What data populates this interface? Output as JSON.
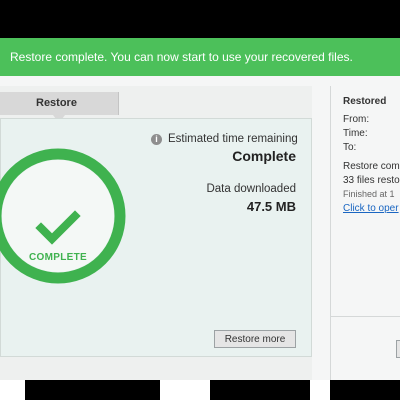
{
  "banner": {
    "message": "Restore complete. You can now start to use your recovered files."
  },
  "restore_tab": {
    "label": "Restore"
  },
  "progress": {
    "eta_label": "Estimated time remaining",
    "eta_value": "Complete",
    "data_label": "Data downloaded",
    "data_value": "47.5 MB",
    "status_text": "COMPLETE",
    "percent": 100
  },
  "actions": {
    "restore_more_label": "Restore more"
  },
  "details": {
    "title": "Restored",
    "from_label": "From:",
    "time_label": "Time:",
    "to_label": "To:",
    "status_line1": "Restore com",
    "status_line2": "33 files resto",
    "finished_text": "Finished at 1",
    "open_link": "Click to oper"
  },
  "colors": {
    "accent": "#4cc05a",
    "ring": "#3fb24f",
    "link": "#1a66c2"
  },
  "icons": {
    "banner": "check-icon",
    "info": "info-icon",
    "status": "checkmark-icon"
  }
}
